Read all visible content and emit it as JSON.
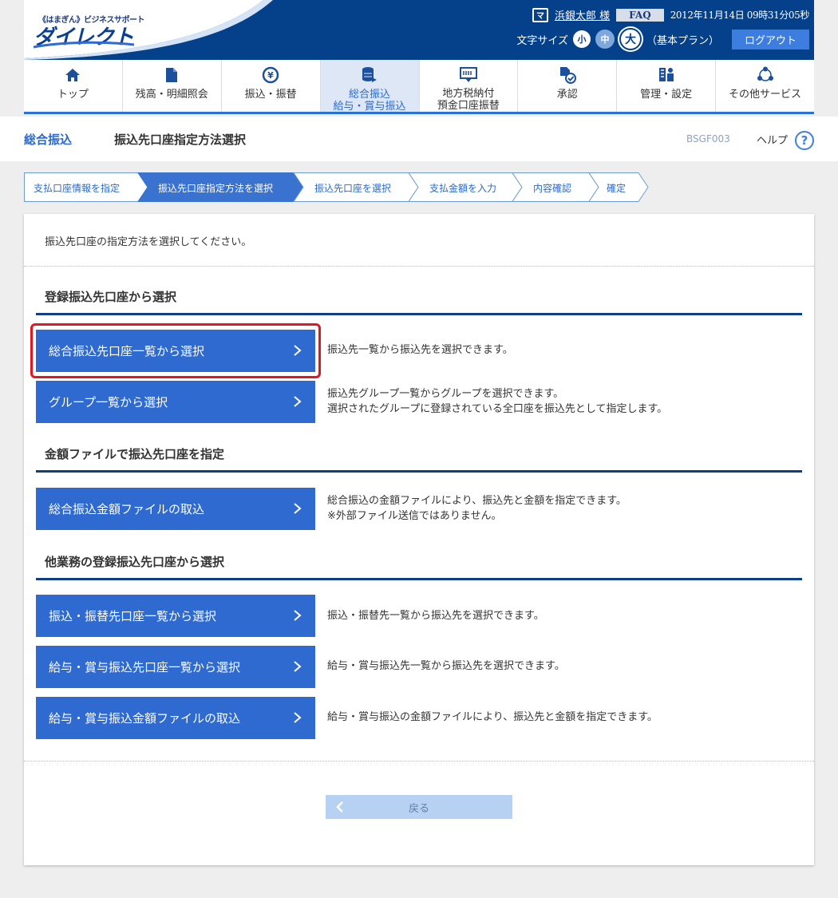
{
  "header": {
    "logo_small": "《はまぎん》ビジネスサポート",
    "logo_big": "ダイレクト",
    "user_badge": "マ",
    "user_name": "浜銀太郎 様",
    "faq": "FAQ",
    "datetime": "2012年11月14日 09時31分05秒",
    "font_size_label": "文字サイズ",
    "font_sizes": [
      "小",
      "中",
      "大"
    ],
    "plan": "（基本プラン）",
    "logout": "ログアウト"
  },
  "nav": {
    "items": [
      {
        "label": "トップ",
        "label2": "",
        "icon": "home-icon"
      },
      {
        "label": "残高・明細照会",
        "label2": "",
        "icon": "document-icon"
      },
      {
        "label": "振込・振替",
        "label2": "",
        "icon": "yen-transfer-icon"
      },
      {
        "label": "総合振込",
        "label2": "給与・賞与振込",
        "icon": "coin-stack-icon"
      },
      {
        "label": "地方税納付",
        "label2": "預金口座振替",
        "icon": "tax-card-icon"
      },
      {
        "label": "承認",
        "label2": "",
        "icon": "approval-icon"
      },
      {
        "label": "管理・設定",
        "label2": "",
        "icon": "admin-icon"
      },
      {
        "label": "その他サービス",
        "label2": "",
        "icon": "network-icon"
      }
    ]
  },
  "title": {
    "category": "総合振込",
    "main": "振込先口座指定方法選択",
    "screen_id": "BSGF003",
    "help": "ヘルプ",
    "help_icon": "?"
  },
  "steps": [
    "支払口座情報を指定",
    "振込先口座指定方法を選択",
    "振込先口座を選択",
    "支払金額を入力",
    "内容確認",
    "確定"
  ],
  "main": {
    "intro": "振込先口座の指定方法を選択してください。",
    "sections": [
      {
        "heading": "登録振込先口座から選択",
        "buttons": [
          {
            "label": "総合振込先口座一覧から選択",
            "desc1": "振込先一覧から振込先を選択できます。",
            "desc2": ""
          },
          {
            "label": "グループ一覧から選択",
            "desc1": "振込先グループ一覧からグループを選択できます。",
            "desc2": "選択されたグループに登録されている全口座を振込先として指定します。"
          }
        ]
      },
      {
        "heading": "金額ファイルで振込先口座を指定",
        "buttons": [
          {
            "label": "総合振込金額ファイルの取込",
            "desc1": "総合振込の金額ファイルにより、振込先と金額を指定できます。",
            "desc2": "※外部ファイル送信ではありません。"
          }
        ]
      },
      {
        "heading": "他業務の登録振込先口座から選択",
        "buttons": [
          {
            "label": "振込・振替先口座一覧から選択",
            "desc1": "振込・振替先一覧から振込先を選択できます。",
            "desc2": ""
          },
          {
            "label": "給与・賞与振込先口座一覧から選択",
            "desc1": "給与・賞与振込先一覧から振込先を選択できます。",
            "desc2": ""
          },
          {
            "label": "給与・賞与振込金額ファイルの取込",
            "desc1": "給与・賞与振込の金額ファイルにより、振込先と金額を指定できます。",
            "desc2": ""
          }
        ]
      }
    ],
    "back": "戻る"
  },
  "colors": {
    "header_bg": "#05408a",
    "accent": "#2f6ad0",
    "highlight": "#e4161f"
  }
}
